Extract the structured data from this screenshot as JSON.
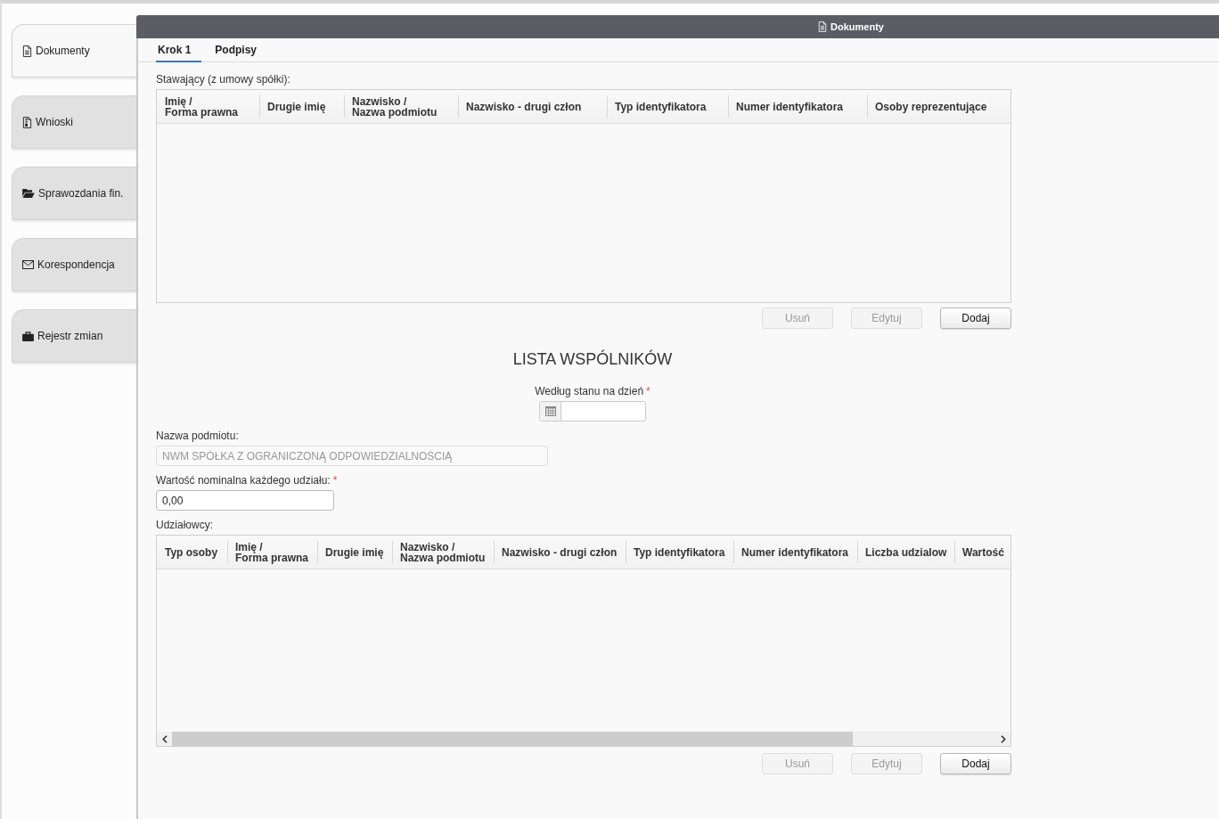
{
  "sidebar": {
    "items": [
      {
        "label": "Dokumenty",
        "selected": true
      },
      {
        "label": "Wnioski",
        "selected": false
      },
      {
        "label": "Sprawozdania fin.",
        "selected": false
      },
      {
        "label": "Korespondencja",
        "selected": false
      },
      {
        "label": "Rejestr zmian",
        "selected": false
      }
    ]
  },
  "panel": {
    "title": "Dokumenty",
    "tabs": [
      {
        "label": "Krok 1",
        "selected": true
      },
      {
        "label": "Podpisy",
        "selected": false
      }
    ],
    "participants": {
      "label": "Stawający (z umowy spółki):",
      "columns": [
        "Imię /\nForma prawna",
        "Drugie imię",
        "Nazwisko /\nNazwa podmiotu",
        "Nazwisko - drugi człon",
        "Typ identyfikatora",
        "Numer identyfikatora",
        "Osoby reprezentujące"
      ],
      "buttons": [
        {
          "label": "Usuń",
          "disabled": true
        },
        {
          "label": "Edytuj",
          "disabled": true
        },
        {
          "label": "Dodaj",
          "disabled": false
        }
      ]
    },
    "shareholder_list": {
      "title": "LISTA WSPÓLNIKÓW",
      "date_field": {
        "label": "Według stanu na dzień",
        "required_mark": "*"
      },
      "entity_name": {
        "label": "Nazwa podmiotu:",
        "value": "NWM SPÓŁKA Z OGRANICZONĄ ODPOWIEDZIALNOŚCIĄ",
        "disabled": true
      },
      "nominal_value": {
        "label": "Wartość nominalna każdego udziału:",
        "required_mark": "*",
        "value": "0,00",
        "disabled": false
      },
      "shareholders": {
        "label": "Udziałowcy:",
        "columns": [
          "Typ osoby",
          "Imię /\nForma prawna",
          "Drugie imię",
          "Nazwisko /\nNazwa podmiotu",
          "Nazwisko - drugi człon",
          "Typ identyfikatora",
          "Numer identyfikatora",
          "Liczba udzialow",
          "Wartość"
        ],
        "buttons": [
          {
            "label": "Usuń",
            "disabled": true
          },
          {
            "label": "Edytuj",
            "disabled": true
          },
          {
            "label": "Dodaj",
            "disabled": false
          }
        ]
      }
    }
  }
}
